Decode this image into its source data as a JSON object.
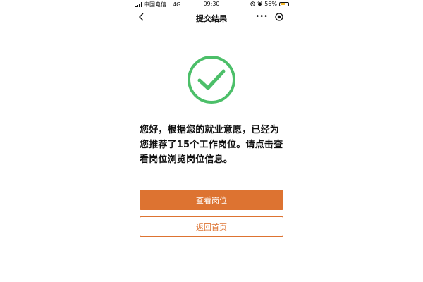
{
  "status_bar": {
    "carrier": "中国电信",
    "network": "4G",
    "time": "09:30",
    "battery_percent": "56%",
    "battery_level": 0.56,
    "icons": [
      "signal-icon",
      "location-icon",
      "alarm-icon",
      "battery-icon"
    ]
  },
  "nav": {
    "title": "提交结果",
    "back_icon": "chevron-left-icon",
    "more_label": "•••",
    "target_icon": "target-icon"
  },
  "result": {
    "icon": "check-circle-icon",
    "message": "您好，根据您的就业意愿，已经为您推荐了15个工作岗位。请点击查看岗位浏览岗位信息。"
  },
  "actions": {
    "primary_label": "查看岗位",
    "secondary_label": "返回首页"
  },
  "colors": {
    "accent": "#dd7331",
    "success": "#4cbf69",
    "battery": "#f3b82c"
  }
}
